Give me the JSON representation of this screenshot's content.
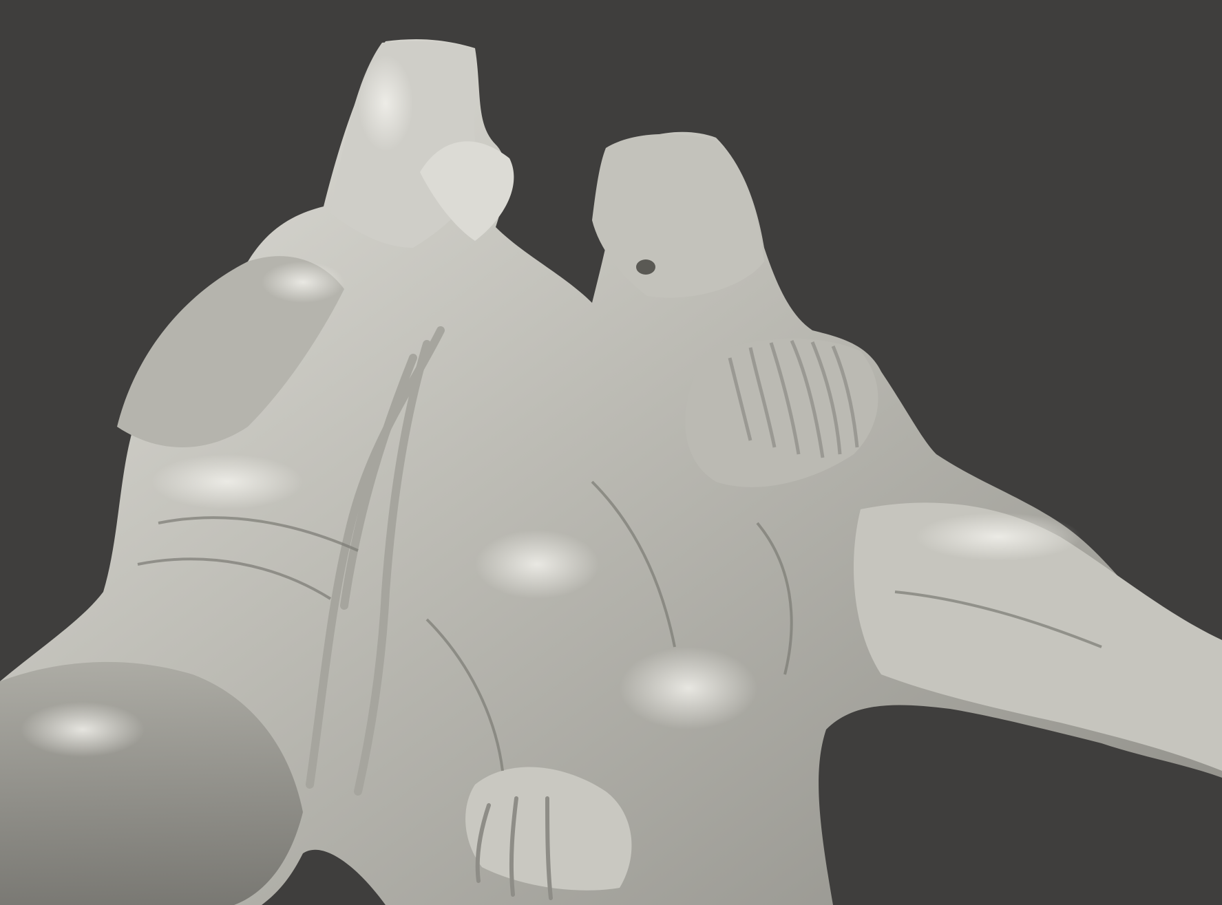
{
  "viewport": {
    "background_color": "#3f3e3d",
    "subject": "sculpt-mesh",
    "material_base_color": "#bdbcb5",
    "material_highlight_color": "#e8e7e1",
    "material_shadow_color": "#6d6c67"
  }
}
